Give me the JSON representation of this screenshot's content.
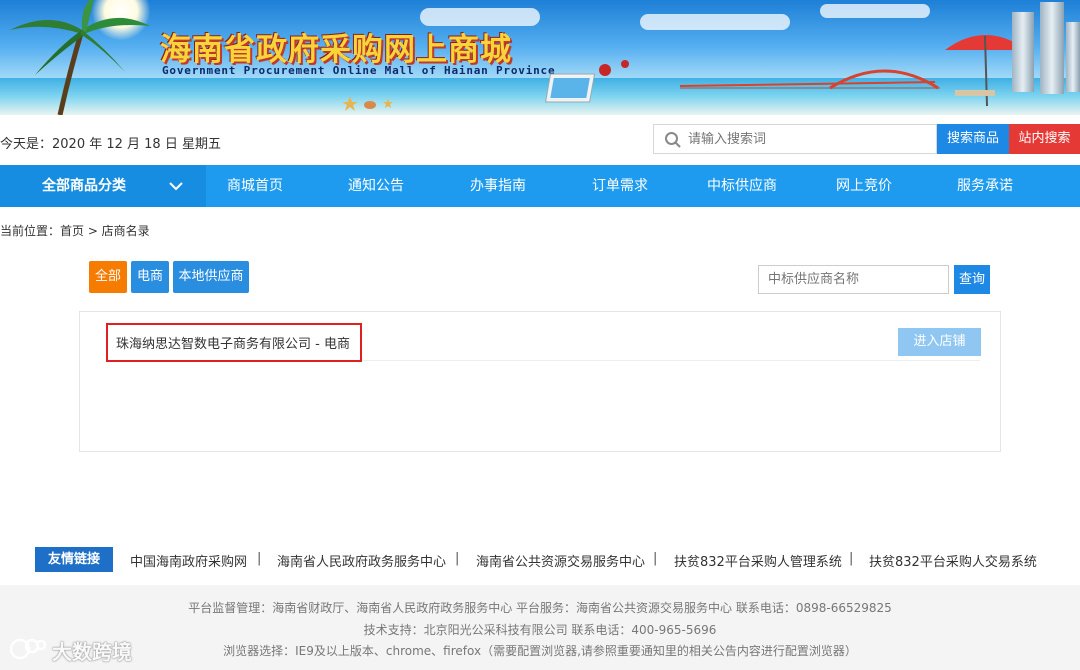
{
  "banner": {
    "title_cn": "海南省政府采购网上商城",
    "title_en": "Government Procurement Online Mall of Hainan Province"
  },
  "header": {
    "date_text": "今天是：2020 年 12 月 18 日 星期五",
    "search_placeholder": "请输入搜索词",
    "search_goods_label": "搜索商品",
    "search_site_label": "站内搜索"
  },
  "nav": {
    "all_categories": "全部商品分类",
    "items": [
      "商城首页",
      "通知公告",
      "办事指南",
      "订单需求",
      "中标供应商",
      "网上竞价",
      "服务承诺"
    ]
  },
  "breadcrumb": "当前位置：首页 > 店商名录",
  "filters": {
    "all": "全部",
    "ecommerce": "电商",
    "local": "本地供应商",
    "supplier_placeholder": "中标供应商名称",
    "query_label": "查询"
  },
  "results": [
    {
      "name": "珠海纳思达智数电子商务有限公司 - 电商",
      "action": "进入店铺"
    }
  ],
  "friend_links": {
    "title": "友情链接",
    "items": [
      "中国海南政府采购网",
      "海南省人民政府政务服务中心",
      "海南省公共资源交易服务中心",
      "扶贫832平台采购人管理系统",
      "扶贫832平台采购人交易系统"
    ],
    "separator": "|"
  },
  "footer": {
    "line1": "平台监督管理：海南省财政厅、海南省人民政府政务服务中心   平台服务：海南省公共资源交易服务中心   联系电话：0898-66529825",
    "line2": "技术支持：北京阳光公采科技有限公司   联系电话：400-965-5696",
    "line3": "浏览器选择：IE9及以上版本、chrome、firefox（需要配置浏览器,请参照重要通知里的相关公告内容进行配置浏览器）"
  },
  "watermark": "大数跨境",
  "colors": {
    "nav_blue": "#1e9bee",
    "primary_blue": "#1e88e5",
    "red": "#e53935",
    "orange": "#f57c00",
    "highlight_red": "#e02020"
  }
}
